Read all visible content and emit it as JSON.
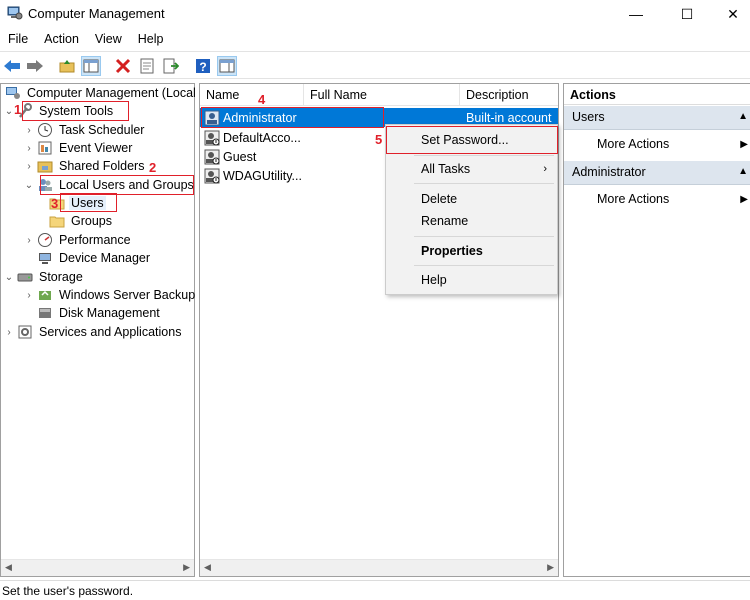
{
  "window": {
    "title": "Computer Management",
    "controls": {
      "minimize": "—",
      "maximize": "☐",
      "close": "✕"
    }
  },
  "menu": [
    "File",
    "Action",
    "View",
    "Help"
  ],
  "tree": {
    "root": "Computer Management (Local",
    "system_tools": "System Tools",
    "task_scheduler": "Task Scheduler",
    "event_viewer": "Event Viewer",
    "shared_folders": "Shared Folders",
    "local_users_groups": "Local Users and Groups",
    "users": "Users",
    "groups": "Groups",
    "performance": "Performance",
    "device_manager": "Device Manager",
    "storage": "Storage",
    "windows_server_backup": "Windows Server Backup",
    "disk_management": "Disk Management",
    "services_apps": "Services and Applications"
  },
  "list": {
    "columns": [
      "Name",
      "Full Name",
      "Description"
    ],
    "rows": [
      {
        "name": "Administrator",
        "full_name": "",
        "description": "Built-in account"
      },
      {
        "name": "DefaultAcco...",
        "full_name": "",
        "description": ""
      },
      {
        "name": "Guest",
        "full_name": "",
        "description": ""
      },
      {
        "name": "WDAGUtility...",
        "full_name": "",
        "description": ""
      }
    ]
  },
  "context_menu": {
    "set_password": "Set Password...",
    "all_tasks": "All Tasks",
    "delete": "Delete",
    "rename": "Rename",
    "properties": "Properties",
    "help": "Help"
  },
  "actions": {
    "title": "Actions",
    "section_users": "Users",
    "section_admin": "Administrator",
    "more_actions": "More Actions"
  },
  "status": "Set the user's password.",
  "annotations": [
    "1",
    "2",
    "3",
    "4",
    "5"
  ],
  "colors": {
    "selection": "#0078d7",
    "annotation": "#e0202a",
    "action_header": "#dde5ee",
    "delete_icon": "#d42020"
  },
  "icons": {
    "app": "computer-management-icon",
    "back": "back-arrow-icon",
    "forward": "forward-arrow-icon",
    "delete": "red-x-icon",
    "help": "help-icon"
  }
}
